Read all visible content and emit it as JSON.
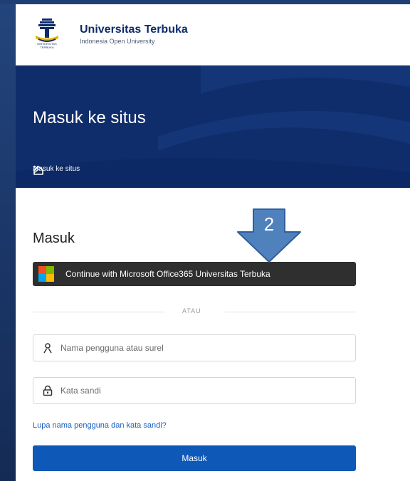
{
  "header": {
    "brand_name": "Universitas Terbuka",
    "brand_subtitle": "Indonesia Open University",
    "logo_caption": "UNIVERSITAS TERBUKA",
    "logo_icon": "ut-logo-icon"
  },
  "banner": {
    "title": "Masuk ke situs",
    "breadcrumb": {
      "home_icon": "home-icon",
      "separator_icon": "chevron-right-icon",
      "current": "Masuk ke situs"
    }
  },
  "login": {
    "heading": "Masuk",
    "microsoft_button": "Continue with Microsoft Office365 Universitas Terbuka",
    "divider": "ATAU",
    "username": {
      "placeholder": "Nama pengguna atau surel",
      "value": "",
      "icon": "user-icon"
    },
    "password": {
      "placeholder": "Kata sandi",
      "value": "",
      "icon": "lock-icon"
    },
    "forgot_link": "Lupa nama pengguna dan kata sandi?",
    "submit": "Masuk"
  },
  "annotation": {
    "label": "2",
    "icon": "arrow-down-icon"
  },
  "colors": {
    "brand": "#0d2b6b",
    "banner": "#0f2d6b",
    "primary": "#0e58b8",
    "link": "#1a5fc1",
    "annotation": "#4f81bd"
  }
}
